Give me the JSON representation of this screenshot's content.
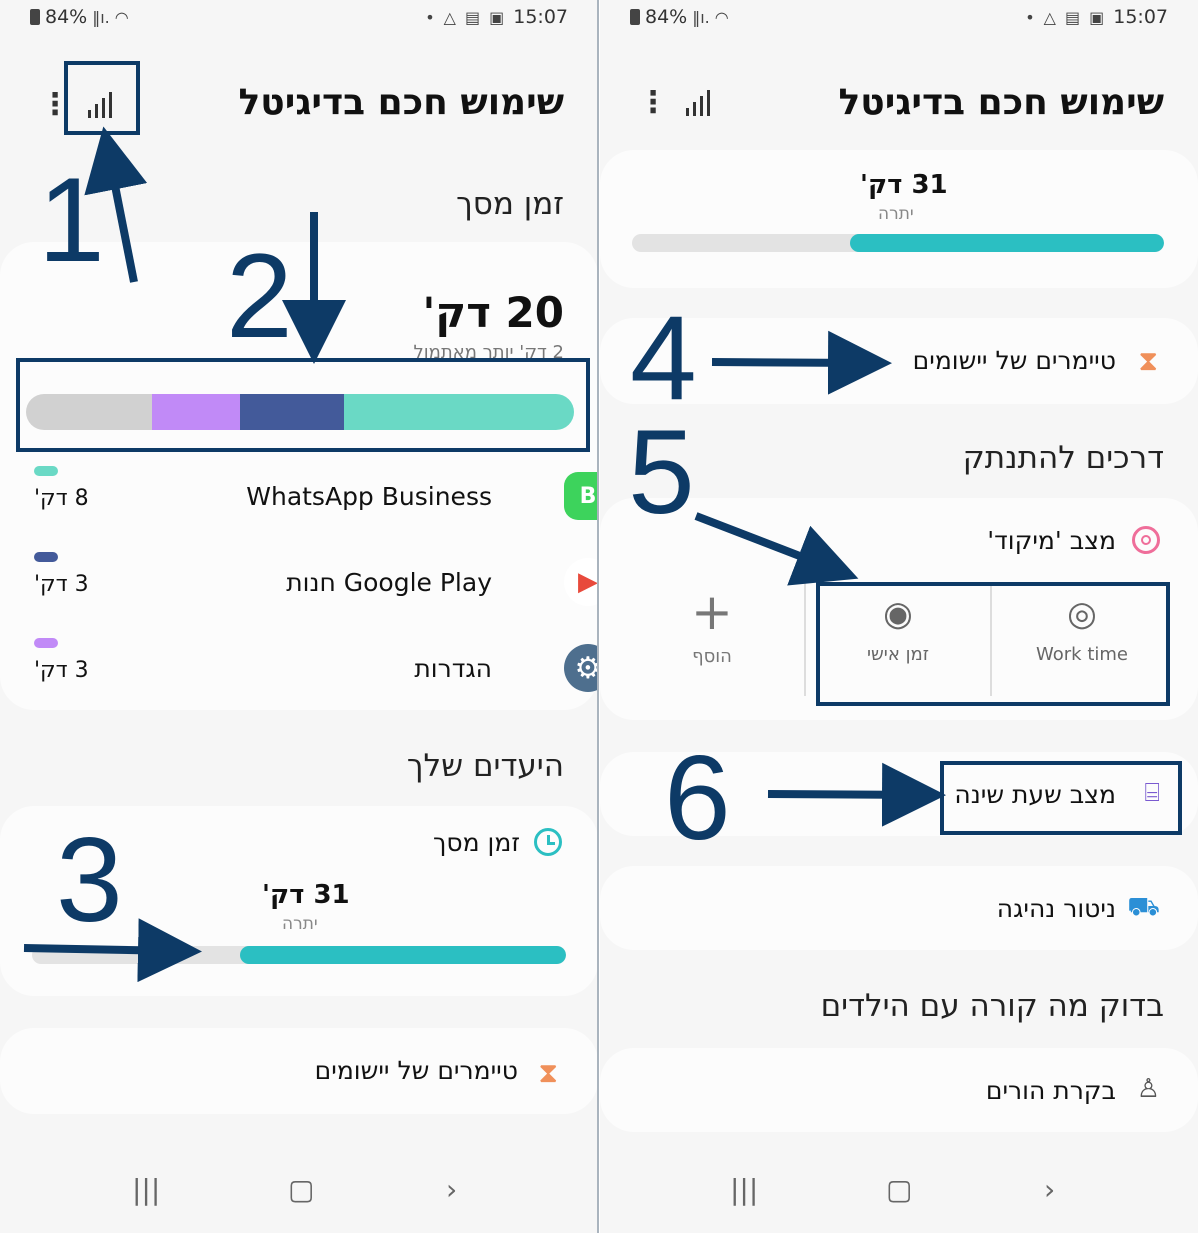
{
  "status": {
    "battery": "84%",
    "time": "15:07"
  },
  "left": {
    "title": "שימוש חכם בדיגיטל",
    "screen_time_section": "זמן מסך",
    "total_time": "20 דק'",
    "subtext": "2 דק' יותר מאתמול",
    "usage_bar": [
      {
        "color": "#d1d1d1",
        "fraction": 0.23
      },
      {
        "color": "#c18af7",
        "fraction": 0.16
      },
      {
        "color": "#435a9a",
        "fraction": 0.19
      },
      {
        "color": "#6ad9c5",
        "fraction": 0.42
      }
    ],
    "apps": [
      {
        "name": "WhatsApp Business",
        "time": "8 דק'",
        "color": "#6ad9c5",
        "icon": "whatsapp-business-icon"
      },
      {
        "name": "חנות Google Play",
        "time": "3 דק'",
        "color": "#435a9a",
        "icon": "google-play-icon"
      },
      {
        "name": "הגדרות",
        "time": "3 דק'",
        "color": "#c18af7",
        "icon": "settings-gear-icon"
      }
    ],
    "goals_section": "היעדים שלך",
    "goal_label": "זמן מסך",
    "goal_time": "31 דק'",
    "goal_sub": "יתרה",
    "goal_progress": 0.61,
    "timers_label": "טיימרים של יישומים",
    "annotations": [
      "1",
      "2",
      "3"
    ]
  },
  "right": {
    "title": "שימוש חכם בדיגיטל",
    "goal_time": "31 דק'",
    "goal_sub": "יתרה",
    "goal_progress": 0.59,
    "timers_label": "טיימרים של יישומים",
    "disconnect_section": "דרכים להתנתק",
    "focus_label": "מצב 'מיקוד'",
    "focus_modes": [
      {
        "label": "Work time",
        "icon": "work-time-icon"
      },
      {
        "label": "זמן אישי",
        "icon": "personal-time-icon"
      },
      {
        "label": "הוסף",
        "icon": "plus-icon"
      }
    ],
    "bedtime_label": "מצב שעת שינה",
    "driving_label": "ניטור נהיגה",
    "kids_section": "בדוק מה קורה עם הילדים",
    "parental_label": "בקרת הורים",
    "annotations": [
      "4",
      "5",
      "6"
    ]
  }
}
